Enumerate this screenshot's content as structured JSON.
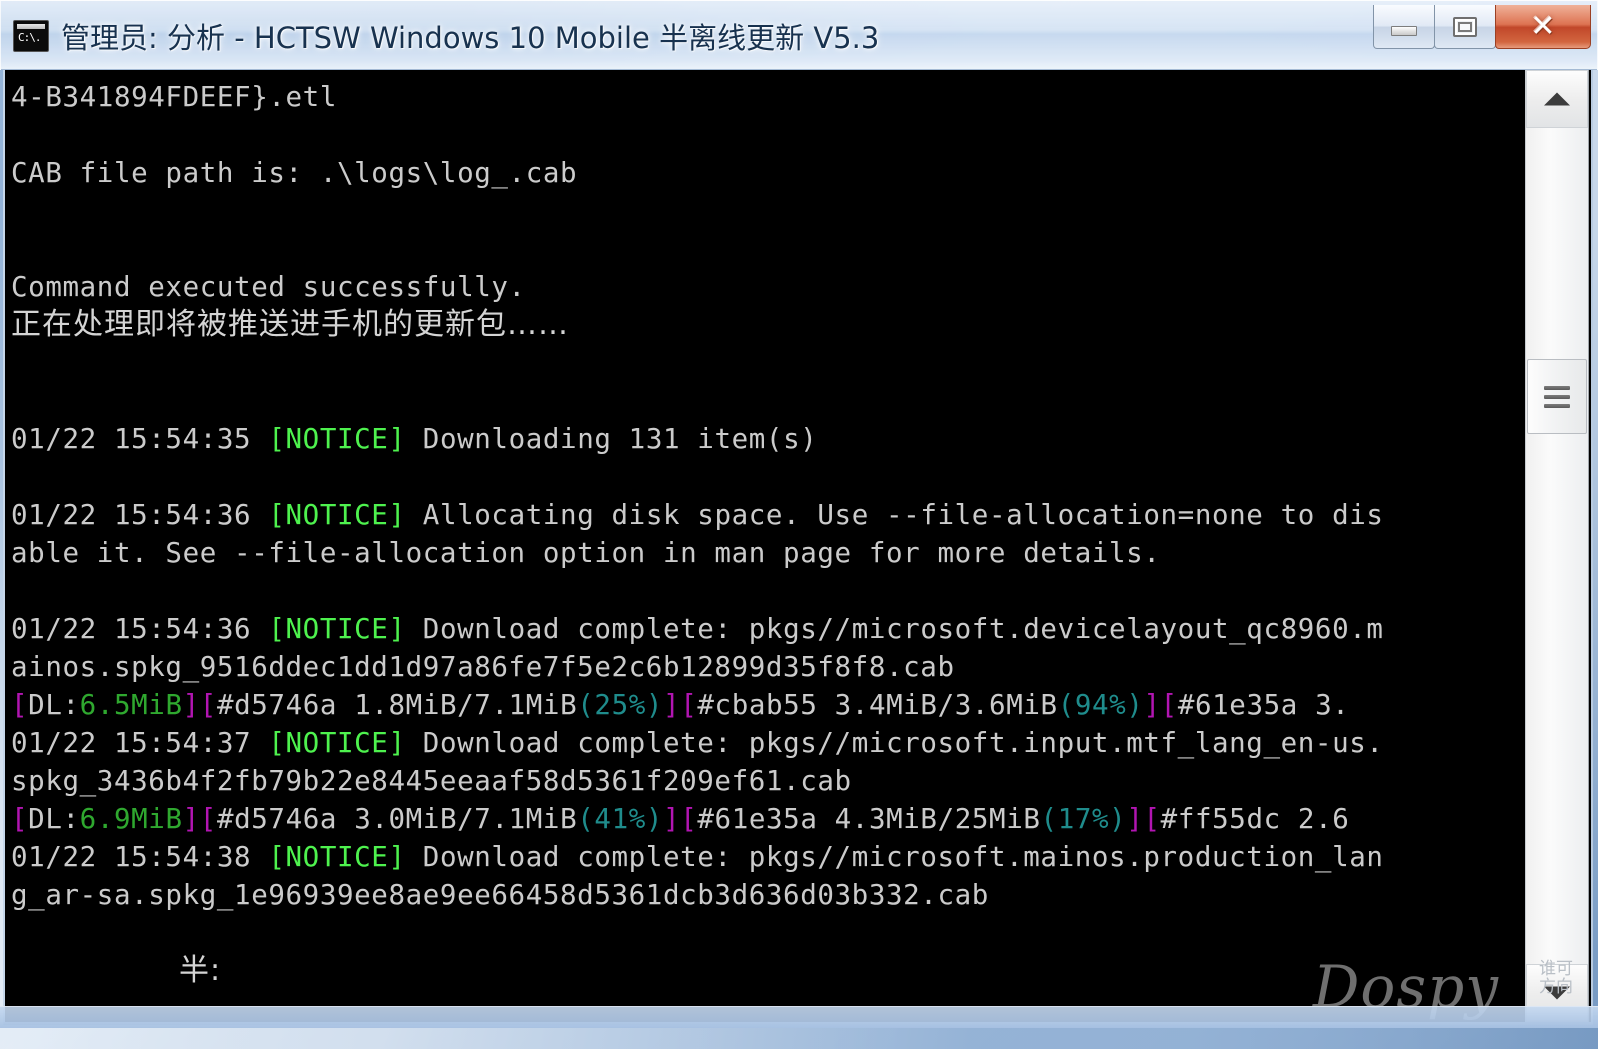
{
  "window": {
    "title": "管理员: 分析 - HCTSW Windows 10 Mobile 半离线更新 V5.3",
    "icon_name": "console-icon",
    "icon_prompt": "C:\\.",
    "controls": {
      "minimize_label": "",
      "maximize_label": "",
      "close_label": "✕"
    },
    "close_color": "#c1472a"
  },
  "console": {
    "background": "#000000",
    "foreground": "#cbcbcb",
    "colors": {
      "notice": "#4ef24e",
      "bracket": "#b215b2",
      "speed": "#2fa82f",
      "percent": "#1f8c8c"
    },
    "lines": [
      {
        "t": "4-B341894FDEEF}.etl"
      },
      {
        "t": ""
      },
      {
        "t": "CAB file path is: .\\logs\\log_.cab"
      },
      {
        "t": ""
      },
      {
        "t": ""
      },
      {
        "t": "Command executed successfully."
      },
      {
        "t": "正在处理即将被推送进手机的更新包……"
      },
      {
        "t": ""
      },
      {
        "t": ""
      },
      {
        "t": "01/22 15:54:35 [NOTICE] Downloading 131 item(s)"
      },
      {
        "t": ""
      },
      {
        "t": "01/22 15:54:36 [NOTICE] Allocating disk space. Use --file-allocation=none to dis"
      },
      {
        "t": "able it. See --file-allocation option in man page for more details."
      },
      {
        "t": ""
      },
      {
        "t": "01/22 15:54:36 [NOTICE] Download complete: pkgs//microsoft.devicelayout_qc8960.m"
      },
      {
        "t": "ainos.spkg_9516ddec1dd1d97a86fe7f5e2c6b12899d35f8f8.cab"
      },
      {
        "t": "[DL:6.5MiB][#d5746a 1.8MiB/7.1MiB(25%)][#cbab55 3.4MiB/3.6MiB(94%)][#61e35a 3."
      },
      {
        "t": "01/22 15:54:37 [NOTICE] Download complete: pkgs//microsoft.input.mtf_lang_en-us."
      },
      {
        "t": "spkg_3436b4f2fb79b22e8445eeaaf58d5361f209ef61.cab"
      },
      {
        "t": "[DL:6.9MiB][#d5746a 3.0MiB/7.1MiB(41%)][#61e35a 4.3MiB/25MiB(17%)][#ff55dc 2.6"
      },
      {
        "t": "01/22 15:54:38 [NOTICE] Download complete: pkgs//microsoft.mainos.production_lan"
      },
      {
        "t": "g_ar-sa.spkg_1e96939ee8ae9ee66458d5361dcb3d636d03b332.cab"
      },
      {
        "t": ""
      },
      {
        "t": "半:",
        "indent": true
      }
    ],
    "detail": {
      "timestamps": [
        "01/22 15:54:35",
        "01/22 15:54:36",
        "01/22 15:54:37",
        "01/22 15:54:38"
      ],
      "level_tag": "[NOTICE]",
      "item_count": "131",
      "cab_path": ".\\logs\\log_.cab",
      "etl_fragment": "4-B341894FDEEF}.etl",
      "downloads": [
        {
          "gid": "#d5746a",
          "done": "1.8MiB",
          "total": "7.1MiB",
          "percent": "25%"
        },
        {
          "gid": "#cbab55",
          "done": "3.4MiB",
          "total": "3.6MiB",
          "percent": "94%"
        },
        {
          "gid": "#61e35a",
          "done": "3.",
          "total": "",
          "percent": ""
        },
        {
          "gid": "#d5746a",
          "done": "3.0MiB",
          "total": "7.1MiB",
          "percent": "41%"
        },
        {
          "gid": "#61e35a",
          "done": "4.3MiB",
          "total": "25MiB",
          "percent": "17%"
        },
        {
          "gid": "#ff55dc",
          "done": "2.6",
          "total": "",
          "percent": ""
        }
      ],
      "speeds": [
        "DL:6.5MiB",
        "DL:6.9MiB"
      ],
      "completed_packages": [
        "pkgs//microsoft.devicelayout_qc8960.mainos.spkg_9516ddec1dd1d97a86fe7f5e2c6b12899d35f8f8.cab",
        "pkgs//microsoft.input.mtf_lang_en-us.spkg_3436b4f2fb79b22e8445eeaaf58d5361f209ef61.cab",
        "pkgs//microsoft.mainos.production_lang_ar-sa.spkg_1e96939ee8ae9ee66458d5361dcb3d636d03b332.cab"
      ]
    }
  },
  "scrollbar": {
    "up_arrow": "▲",
    "down_arrow": "▼",
    "overlay_text": "谁可\n方向"
  },
  "watermark": {
    "text": "Dospy"
  }
}
